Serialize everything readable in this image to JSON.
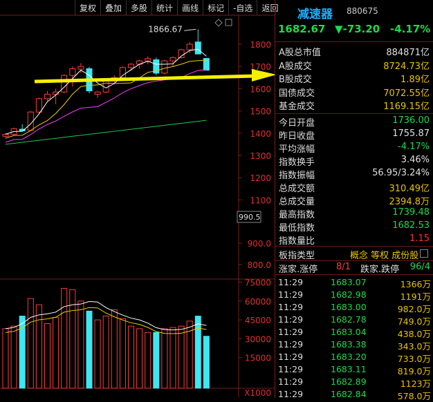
{
  "toolbar": {
    "items": [
      "复权",
      "叠加",
      "多股",
      "统计",
      "画线",
      "标记",
      "-自选",
      "返回"
    ]
  },
  "chart_data": {
    "type": "candlestick",
    "price_axis": {
      "ticks": [
        1800,
        1700,
        1600,
        1500,
        1400,
        1300,
        1200,
        1100,
        900.0,
        800.0
      ],
      "tick_labels": [
        "1800",
        "1700",
        "1600",
        "1500",
        "1400",
        "1300",
        "1200",
        "1100",
        "900.0",
        "800.0"
      ],
      "range": [
        780,
        1880
      ],
      "current_marker": "990.5"
    },
    "annotation": "1866.67",
    "candles": [
      {
        "o": 1386,
        "h": 1400,
        "l": 1380,
        "c": 1395
      },
      {
        "o": 1395,
        "h": 1425,
        "l": 1390,
        "c": 1420
      },
      {
        "o": 1418,
        "h": 1440,
        "l": 1408,
        "c": 1410
      },
      {
        "o": 1412,
        "h": 1500,
        "l": 1410,
        "c": 1495
      },
      {
        "o": 1495,
        "h": 1560,
        "l": 1490,
        "c": 1555
      },
      {
        "o": 1555,
        "h": 1590,
        "l": 1545,
        "c": 1575
      },
      {
        "o": 1575,
        "h": 1600,
        "l": 1530,
        "c": 1585
      },
      {
        "o": 1585,
        "h": 1665,
        "l": 1580,
        "c": 1660
      },
      {
        "o": 1660,
        "h": 1700,
        "l": 1610,
        "c": 1690
      },
      {
        "o": 1688,
        "h": 1715,
        "l": 1670,
        "c": 1700
      },
      {
        "o": 1690,
        "h": 1698,
        "l": 1580,
        "c": 1590
      },
      {
        "o": 1575,
        "h": 1590,
        "l": 1560,
        "c": 1585
      },
      {
        "o": 1585,
        "h": 1640,
        "l": 1580,
        "c": 1635
      },
      {
        "o": 1635,
        "h": 1660,
        "l": 1620,
        "c": 1650
      },
      {
        "o": 1650,
        "h": 1700,
        "l": 1645,
        "c": 1695
      },
      {
        "o": 1695,
        "h": 1715,
        "l": 1680,
        "c": 1710
      },
      {
        "o": 1710,
        "h": 1730,
        "l": 1690,
        "c": 1725
      },
      {
        "o": 1725,
        "h": 1745,
        "l": 1710,
        "c": 1735
      },
      {
        "o": 1730,
        "h": 1740,
        "l": 1660,
        "c": 1670
      },
      {
        "o": 1670,
        "h": 1730,
        "l": 1665,
        "c": 1725
      },
      {
        "o": 1725,
        "h": 1745,
        "l": 1700,
        "c": 1740
      },
      {
        "o": 1740,
        "h": 1780,
        "l": 1735,
        "c": 1775
      },
      {
        "o": 1775,
        "h": 1810,
        "l": 1760,
        "c": 1800
      },
      {
        "o": 1810,
        "h": 1867,
        "l": 1755,
        "c": 1756
      },
      {
        "o": 1736,
        "h": 1739,
        "l": 1682,
        "c": 1683
      }
    ],
    "volume_axis": {
      "ticks": [
        75000,
        60000,
        45000,
        30000,
        15000
      ],
      "tick_labels": [
        "75000",
        "60000",
        "45000",
        "30000",
        "15000"
      ],
      "unit_label": "X1000",
      "range": [
        0,
        80000
      ]
    },
    "volumes": [
      38000,
      40000,
      48000,
      62000,
      57000,
      42000,
      47000,
      70000,
      69000,
      60000,
      52000,
      45000,
      48000,
      53000,
      46000,
      40000,
      38000,
      35000,
      35000,
      38000,
      39000,
      40000,
      44000,
      48000,
      32000
    ]
  },
  "stock": {
    "name": "减速器",
    "code": "880675",
    "price": "1682.67",
    "change": "▼-73.20",
    "change_pct": "-4.17%"
  },
  "stats": [
    {
      "label": "A股总市值",
      "value": "884871亿",
      "color": "#e0e0e0"
    },
    {
      "label": "A股成交",
      "value": "8724.73亿",
      "color": "#e8c400"
    },
    {
      "label": "B股成交",
      "value": "1.89亿",
      "color": "#e8c400"
    },
    {
      "label": "国债成交",
      "value": "7072.55亿",
      "color": "#e8c400"
    },
    {
      "label": "基金成交",
      "value": "1169.15亿",
      "color": "#e8c400"
    },
    {
      "label": "今日开盘",
      "value": "1736.00",
      "color": "#1fd94a"
    },
    {
      "label": "昨日收盘",
      "value": "1755.87",
      "color": "#e0e0e0"
    },
    {
      "label": "平均涨幅",
      "value": "-4.17%",
      "color": "#1fd94a"
    },
    {
      "label": "指数换手",
      "value": "3.46%",
      "color": "#e0e0e0"
    },
    {
      "label": "指数振幅",
      "value": "56.95/3.24%",
      "color": "#e0e0e0"
    },
    {
      "label": "总成交额",
      "value": "310.49亿",
      "color": "#e8c400"
    },
    {
      "label": "总成交量",
      "value": "2394.8万",
      "color": "#e8c400"
    },
    {
      "label": "最高指数",
      "value": "1739.48",
      "color": "#1fd94a"
    },
    {
      "label": "最低指数",
      "value": "1682.53",
      "color": "#1fd94a"
    },
    {
      "label": "指数量比",
      "value": "1.15",
      "color": "#ff3030"
    }
  ],
  "index_kind": {
    "label": "板指类型",
    "value": "概念 等权 成份股"
  },
  "breadth": {
    "up_label": "涨家.涨停",
    "up_value": "8/1",
    "down_label": "跌家.跌停",
    "down_value": "96/4"
  },
  "ticks": [
    {
      "time": "11:29",
      "price": "1683.07",
      "volume": "1366万"
    },
    {
      "time": "11:29",
      "price": "1682.98",
      "volume": "1191万"
    },
    {
      "time": "11:29",
      "price": "1683.00",
      "volume": "982.0万"
    },
    {
      "time": "11:29",
      "price": "1682.78",
      "volume": "749.0万"
    },
    {
      "time": "11:29",
      "price": "1683.04",
      "volume": "438.0万"
    },
    {
      "time": "11:29",
      "price": "1683.38",
      "volume": "343.0万"
    },
    {
      "time": "11:29",
      "price": "1683.20",
      "volume": "733.0万"
    },
    {
      "time": "11:29",
      "price": "1683.11",
      "volume": "819.0万"
    },
    {
      "time": "11:29",
      "price": "1682.89",
      "volume": "1123万"
    },
    {
      "time": "11:29",
      "price": "1682.84",
      "volume": "578.0万"
    }
  ],
  "colors": {
    "up": "#ff3b3b",
    "down": "#3ee6f0",
    "ma5": "#ffffff",
    "ma10": "#f0d000",
    "ma20": "#ff3cff",
    "ma60": "#1ecb4a",
    "grid": "#7a1c1c",
    "axis_text": "#e03030",
    "arrow": "#f5f000"
  }
}
